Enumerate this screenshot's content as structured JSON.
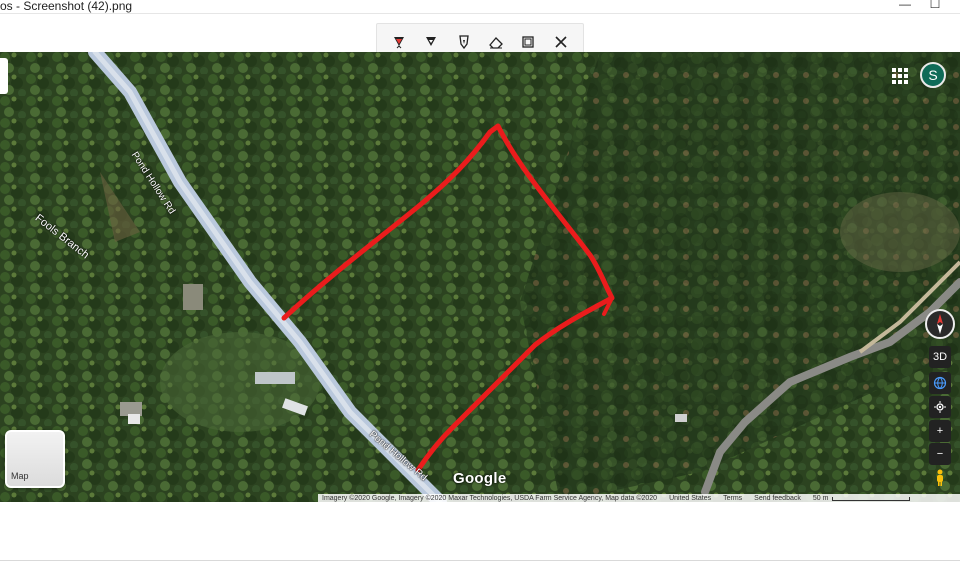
{
  "window": {
    "title": "os - Screenshot (42).png",
    "minimize_glyph": "—",
    "maximize_glyph": "☐"
  },
  "toolbar": {
    "tools": [
      {
        "icon": "ballpoint-pen-icon"
      },
      {
        "icon": "pencil-icon"
      },
      {
        "icon": "highlighter-icon"
      },
      {
        "icon": "eraser-icon"
      },
      {
        "icon": "crop-icon"
      },
      {
        "icon": "close-icon"
      }
    ]
  },
  "map": {
    "labels": {
      "road_upper": "Pond Hollow Rd",
      "road_lower": "Pond Hollow Rd",
      "stream": "Fools Branch"
    },
    "logo": "Google",
    "layer_toggle": "Map",
    "controls": {
      "three_d": "3D",
      "zoom_in": "+",
      "zoom_out": "−"
    },
    "account_initial": "S",
    "attribution": "Imagery ©2020 Google, Imagery ©2020 Maxar Technologies, USDA Farm Service Agency, Map data ©2020",
    "country": "United States",
    "terms": "Terms",
    "send_feedback": "Send feedback",
    "scale": "50 m",
    "annotation_color": "#ea1c1c"
  }
}
